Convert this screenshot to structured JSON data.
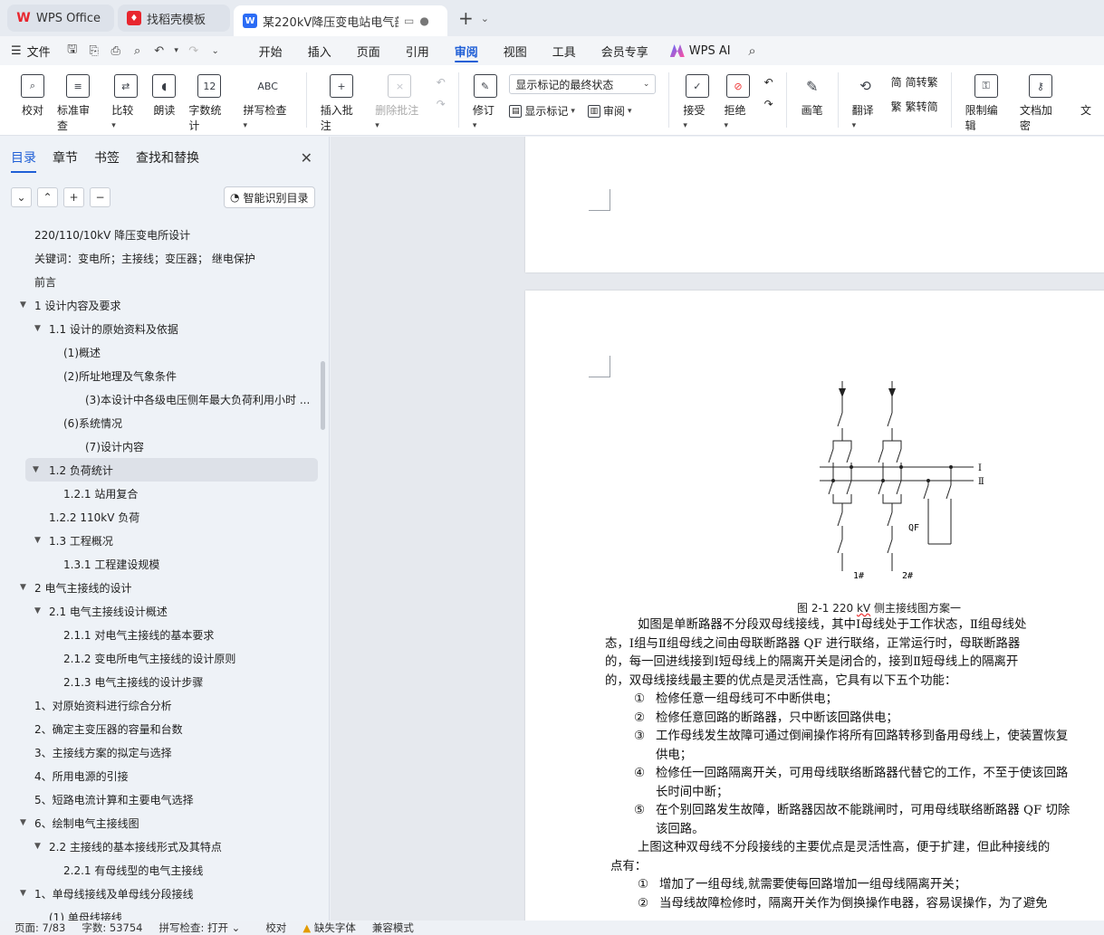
{
  "tabs": [
    {
      "title": "WPS Office",
      "icon": "wps-icon"
    },
    {
      "title": "找稻壳模板",
      "icon": "docer-icon"
    },
    {
      "title": "某220kV降压变电站电气部分",
      "icon": "writer-icon"
    }
  ],
  "menubar": {
    "file_label": "文件",
    "items": [
      "开始",
      "插入",
      "页面",
      "引用",
      "审阅",
      "视图",
      "工具",
      "会员专享"
    ],
    "active": "审阅",
    "ai_label": "WPS AI"
  },
  "ribbon": {
    "proofing": [
      "校对",
      "标准审查",
      "比较",
      "朗读",
      "字数统计",
      "拼写检查"
    ],
    "comments": {
      "insert": "插入批注",
      "delete": "删除批注"
    },
    "tracking": {
      "revise": "修订",
      "display_state": "显示标记的最终状态",
      "show_markup": "显示标记",
      "review": "审阅"
    },
    "changes": {
      "accept": "接受",
      "reject": "拒绝"
    },
    "ink": "画笔",
    "translate": {
      "translate": "翻译",
      "to_traditional": "简转繁",
      "to_simplified": "繁转简"
    },
    "protect": {
      "restrict": "限制编辑",
      "encrypt": "文档加密",
      "more": "文"
    }
  },
  "nav": {
    "tabs": [
      "目录",
      "章节",
      "书签",
      "查找和替换"
    ],
    "active_tab": "目录",
    "smart_button": "智能识别目录",
    "toc": [
      {
        "text": "220/110/10kV 降压变电所设计",
        "level": 0,
        "tri": false
      },
      {
        "text": "关键词：变电所；主接线；变压器；  继电保护",
        "level": 0,
        "tri": false
      },
      {
        "text": "前言",
        "level": 0,
        "tri": false
      },
      {
        "text": "1  设计内容及要求",
        "level": 0,
        "tri": true
      },
      {
        "text": "1.1  设计的原始资料及依据",
        "level": 1,
        "tri": true
      },
      {
        "text": "(1)概述",
        "level": 2,
        "tri": false
      },
      {
        "text": "(2)所址地理及气象条件",
        "level": 2,
        "tri": false
      },
      {
        "text": "(3)本设计中各级电压侧年最大负荷利用小时 ...",
        "level": 3,
        "tri": false
      },
      {
        "text": "(6)系统情况",
        "level": 2,
        "tri": false
      },
      {
        "text": "(7)设计内容",
        "level": 3,
        "tri": false
      },
      {
        "text": "1.2  负荷统计",
        "level": 1,
        "tri": true,
        "selected": true
      },
      {
        "text": "1.2.1  站用复合",
        "level": 2,
        "tri": false
      },
      {
        "text": "1.2.2 110kV 负荷",
        "level": 1,
        "tri": false
      },
      {
        "text": "1.3  工程概况",
        "level": 1,
        "tri": true
      },
      {
        "text": "1.3.1  工程建设规模",
        "level": 2,
        "tri": false
      },
      {
        "text": "2  电气主接线的设计",
        "level": 0,
        "tri": true
      },
      {
        "text": "2.1  电气主接线设计概述",
        "level": 1,
        "tri": true
      },
      {
        "text": "2.1.1  对电气主接线的基本要求",
        "level": 2,
        "tri": false
      },
      {
        "text": "2.1.2  变电所电气主接线的设计原则",
        "level": 2,
        "tri": false
      },
      {
        "text": "2.1.3  电气主接线的设计步骤",
        "level": 2,
        "tri": false
      },
      {
        "text": "1、对原始资料进行综合分析",
        "level": 0,
        "tri": false
      },
      {
        "text": "2、确定主变压器的容量和台数",
        "level": 0,
        "tri": false
      },
      {
        "text": "3、主接线方案的拟定与选择",
        "level": 0,
        "tri": false
      },
      {
        "text": "4、所用电源的引接",
        "level": 0,
        "tri": false
      },
      {
        "text": "5、短路电流计算和主要电气选择",
        "level": 0,
        "tri": false
      },
      {
        "text": "6、绘制电气主接线图",
        "level": 0,
        "tri": true
      },
      {
        "text": "2.2   主接线的基本接线形式及其特点",
        "level": 1,
        "tri": true
      },
      {
        "text": "2.2.1  有母线型的电气主接线",
        "level": 2,
        "tri": false
      },
      {
        "text": "1、单母线接线及单母线分段接线",
        "level": 0,
        "tri": true
      },
      {
        "text": "(1)  单母线接线",
        "level": 1,
        "tri": false
      }
    ]
  },
  "document": {
    "diagram_labels": {
      "bus1": "Ⅰ",
      "bus2": "Ⅱ",
      "qf": "QF",
      "line1": "1#",
      "line2": "2#"
    },
    "caption_prefix": "图 2-1   220 ",
    "caption_kv": "kV",
    "caption_suffix": " 侧主接线图方案一",
    "para1": [
      "如图是单断路器不分段双母线接线，其中Ⅰ母线处于工作状态，Ⅱ组母线处",
      "态，Ⅰ组与Ⅱ组母线之间由母联断路器 QF 进行联络，正常运行时，母联断路器",
      "的，每一回进线接到Ⅰ短母线上的隔离开关是闭合的，接到Ⅱ短母线上的隔离开",
      "的，双母线接线最主要的优点是灵活性高，它具有以下五个功能："
    ],
    "functions": [
      {
        "num": "①",
        "text": "检修任意一组母线可不中断供电；"
      },
      {
        "num": "②",
        "text": "检修任意回路的断路器，只中断该回路供电；"
      },
      {
        "num": "③",
        "text": "工作母线发生故障可通过倒闸操作将所有回路转移到备用母线上，使装置恢复",
        "cont": "供电；"
      },
      {
        "num": "④",
        "text": "检修任一回路隔离开关，可用母线联络断路器代替它的工作，不至于使该回路",
        "cont": "长时间中断；"
      },
      {
        "num": "⑤",
        "text": "在个别回路发生故障，断路器因故不能跳闸时，可用母线联络断路器 QF 切除",
        "cont": "该回路。"
      }
    ],
    "para2": "上图这种双母线不分段接线的主要优点是灵活性高，便于扩建，但此种接线的",
    "para2_cont": "点有：",
    "drawbacks": [
      {
        "num": "①",
        "text": "增加了一组母线,就需要使每回路增加一组母线隔离开关；"
      },
      {
        "num": "②",
        "text": "当母线故障检修时，隔离开关作为倒换操作电器，容易误操作，为了避免"
      }
    ]
  },
  "status": {
    "page": "页面: 7/83",
    "words": "字数: 53754",
    "spell": "拼写检查: 打开",
    "proof": "校对",
    "missing_font": "缺失字体",
    "compat": "兼容模式"
  }
}
